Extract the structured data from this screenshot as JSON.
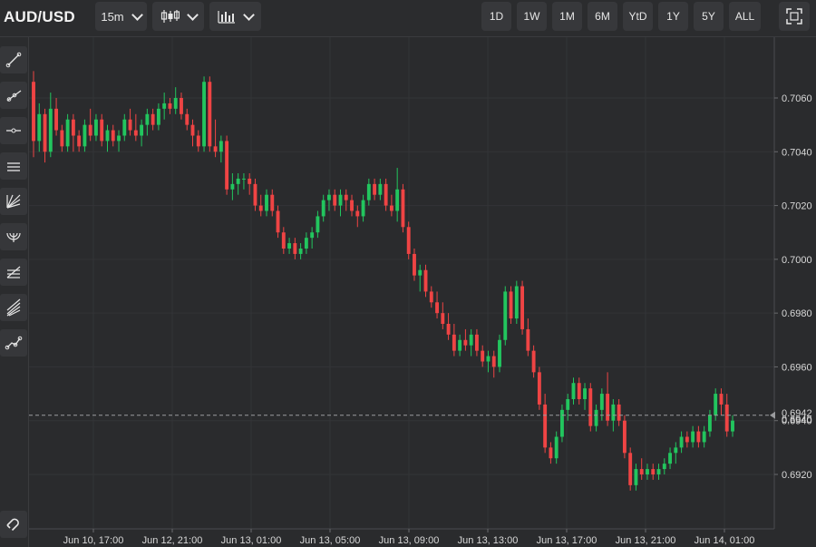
{
  "header": {
    "symbol": "AUD/USD",
    "interval": "15m",
    "chart_style_icon": "candlestick-icon",
    "indicators_icon": "indicators-icon",
    "ranges": [
      "1D",
      "1W",
      "1M",
      "6M",
      "YtD",
      "1Y",
      "5Y",
      "ALL"
    ],
    "fullscreen_icon": "fullscreen-icon"
  },
  "toolbar": {
    "tools": [
      "trend-line-icon",
      "ray-icon",
      "horizontal-line-icon",
      "parallel-channel-icon",
      "fib-fan-icon",
      "fib-arc-icon",
      "fib-retracement-icon",
      "pitchfork-icon",
      "polyline-icon"
    ],
    "bottom_tool": "magnet-icon"
  },
  "chart_data": {
    "type": "candlestick",
    "title": "",
    "ylim": [
      0.69,
      0.708
    ],
    "y_ticks": [
      "0.7060",
      "0.7040",
      "0.7020",
      "0.7000",
      "0.6980",
      "0.6960",
      "0.6940",
      "0.6920"
    ],
    "x_ticks": [
      "Jun 10, 17:00",
      "Jun 12, 21:00",
      "Jun 13, 01:00",
      "Jun 13, 05:00",
      "Jun 13, 09:00",
      "Jun 13, 13:00",
      "Jun 13, 17:00",
      "Jun 13, 21:00",
      "Jun 14, 01:00"
    ],
    "last_price_label": "0.6942",
    "last_price": 0.6942,
    "price_scale_label": "0.6940",
    "up_color": "#22c55e",
    "down_color": "#ef4444",
    "candles": [
      [
        0.7066,
        0.707,
        0.7038,
        0.7044
      ],
      [
        0.7044,
        0.7058,
        0.704,
        0.7054
      ],
      [
        0.7054,
        0.7056,
        0.7036,
        0.704
      ],
      [
        0.704,
        0.7062,
        0.7038,
        0.7056
      ],
      [
        0.7056,
        0.706,
        0.7046,
        0.7048
      ],
      [
        0.7048,
        0.705,
        0.704,
        0.7042
      ],
      [
        0.7042,
        0.7054,
        0.704,
        0.7052
      ],
      [
        0.7052,
        0.7054,
        0.704,
        0.7046
      ],
      [
        0.7046,
        0.7048,
        0.704,
        0.7042
      ],
      [
        0.7042,
        0.7052,
        0.704,
        0.705
      ],
      [
        0.705,
        0.7056,
        0.7044,
        0.7046
      ],
      [
        0.7046,
        0.7054,
        0.7044,
        0.7052
      ],
      [
        0.7052,
        0.7054,
        0.7042,
        0.7044
      ],
      [
        0.7044,
        0.705,
        0.704,
        0.7048
      ],
      [
        0.7048,
        0.705,
        0.7042,
        0.7044
      ],
      [
        0.7044,
        0.7048,
        0.704,
        0.7046
      ],
      [
        0.7046,
        0.7054,
        0.7044,
        0.7052
      ],
      [
        0.7052,
        0.7056,
        0.7046,
        0.7048
      ],
      [
        0.7048,
        0.7054,
        0.7044,
        0.7046
      ],
      [
        0.7046,
        0.7052,
        0.7042,
        0.705
      ],
      [
        0.705,
        0.7056,
        0.7046,
        0.7054
      ],
      [
        0.7054,
        0.7056,
        0.7048,
        0.705
      ],
      [
        0.705,
        0.7058,
        0.7048,
        0.7056
      ],
      [
        0.7056,
        0.7062,
        0.7052,
        0.7058
      ],
      [
        0.7058,
        0.706,
        0.7054,
        0.7056
      ],
      [
        0.7056,
        0.7064,
        0.7054,
        0.706
      ],
      [
        0.706,
        0.7062,
        0.7052,
        0.7054
      ],
      [
        0.7054,
        0.7056,
        0.7048,
        0.705
      ],
      [
        0.705,
        0.7052,
        0.7042,
        0.7046
      ],
      [
        0.7046,
        0.7048,
        0.704,
        0.7042
      ],
      [
        0.7042,
        0.7068,
        0.704,
        0.7066
      ],
      [
        0.7066,
        0.7068,
        0.704,
        0.7042
      ],
      [
        0.7042,
        0.7052,
        0.7038,
        0.704
      ],
      [
        0.704,
        0.7046,
        0.7036,
        0.7044
      ],
      [
        0.7044,
        0.7046,
        0.7024,
        0.7026
      ],
      [
        0.7026,
        0.7032,
        0.7022,
        0.7028
      ],
      [
        0.7028,
        0.7032,
        0.7024,
        0.703
      ],
      [
        0.703,
        0.7032,
        0.7026,
        0.703
      ],
      [
        0.703,
        0.7032,
        0.7024,
        0.7028
      ],
      [
        0.7028,
        0.703,
        0.7018,
        0.702
      ],
      [
        0.702,
        0.7024,
        0.7016,
        0.7018
      ],
      [
        0.7018,
        0.7026,
        0.7016,
        0.7024
      ],
      [
        0.7024,
        0.7026,
        0.7016,
        0.7018
      ],
      [
        0.7018,
        0.702,
        0.7008,
        0.701
      ],
      [
        0.701,
        0.7012,
        0.7002,
        0.7004
      ],
      [
        0.7004,
        0.7008,
        0.7002,
        0.7006
      ],
      [
        0.7006,
        0.7008,
        0.7,
        0.7002
      ],
      [
        0.7002,
        0.7006,
        0.7,
        0.7004
      ],
      [
        0.7004,
        0.701,
        0.7002,
        0.7008
      ],
      [
        0.7008,
        0.7012,
        0.7004,
        0.701
      ],
      [
        0.701,
        0.7018,
        0.7008,
        0.7016
      ],
      [
        0.7016,
        0.7024,
        0.7014,
        0.7022
      ],
      [
        0.7022,
        0.7026,
        0.7018,
        0.7024
      ],
      [
        0.7024,
        0.7026,
        0.7018,
        0.702
      ],
      [
        0.702,
        0.7026,
        0.7016,
        0.7024
      ],
      [
        0.7024,
        0.7026,
        0.7018,
        0.7022
      ],
      [
        0.7022,
        0.7024,
        0.7016,
        0.7018
      ],
      [
        0.7018,
        0.702,
        0.7012,
        0.7016
      ],
      [
        0.7016,
        0.7024,
        0.7014,
        0.7022
      ],
      [
        0.7022,
        0.703,
        0.702,
        0.7028
      ],
      [
        0.7028,
        0.703,
        0.7022,
        0.7024
      ],
      [
        0.7024,
        0.703,
        0.7022,
        0.7028
      ],
      [
        0.7028,
        0.703,
        0.7018,
        0.702
      ],
      [
        0.702,
        0.7024,
        0.7016,
        0.7018
      ],
      [
        0.7018,
        0.7034,
        0.7014,
        0.7026
      ],
      [
        0.7026,
        0.7028,
        0.701,
        0.7012
      ],
      [
        0.7012,
        0.7014,
        0.7,
        0.7002
      ],
      [
        0.7002,
        0.7004,
        0.6992,
        0.6994
      ],
      [
        0.6994,
        0.6998,
        0.6988,
        0.6996
      ],
      [
        0.6996,
        0.6998,
        0.6986,
        0.6988
      ],
      [
        0.6988,
        0.699,
        0.6982,
        0.6984
      ],
      [
        0.6984,
        0.6988,
        0.6978,
        0.698
      ],
      [
        0.698,
        0.6984,
        0.6974,
        0.6976
      ],
      [
        0.6976,
        0.698,
        0.697,
        0.6972
      ],
      [
        0.6972,
        0.6976,
        0.6964,
        0.6966
      ],
      [
        0.6966,
        0.6972,
        0.6964,
        0.697
      ],
      [
        0.697,
        0.6974,
        0.6966,
        0.6968
      ],
      [
        0.6968,
        0.6974,
        0.6964,
        0.6972
      ],
      [
        0.6972,
        0.6974,
        0.6964,
        0.6966
      ],
      [
        0.6966,
        0.6968,
        0.696,
        0.6962
      ],
      [
        0.6962,
        0.6966,
        0.6958,
        0.6964
      ],
      [
        0.6964,
        0.6966,
        0.6956,
        0.696
      ],
      [
        0.696,
        0.6972,
        0.6958,
        0.697
      ],
      [
        0.697,
        0.699,
        0.6968,
        0.6988
      ],
      [
        0.6988,
        0.699,
        0.6976,
        0.6978
      ],
      [
        0.6978,
        0.6992,
        0.6976,
        0.699
      ],
      [
        0.699,
        0.6992,
        0.6972,
        0.6974
      ],
      [
        0.6974,
        0.6978,
        0.6964,
        0.6966
      ],
      [
        0.6966,
        0.6968,
        0.6956,
        0.6958
      ],
      [
        0.6958,
        0.696,
        0.6944,
        0.6946
      ],
      [
        0.6946,
        0.695,
        0.6928,
        0.693
      ],
      [
        0.693,
        0.6932,
        0.6924,
        0.6926
      ],
      [
        0.6926,
        0.6936,
        0.6924,
        0.6934
      ],
      [
        0.6934,
        0.6946,
        0.6932,
        0.6944
      ],
      [
        0.6944,
        0.695,
        0.694,
        0.6948
      ],
      [
        0.6948,
        0.6956,
        0.6946,
        0.6954
      ],
      [
        0.6954,
        0.6956,
        0.6946,
        0.6948
      ],
      [
        0.6948,
        0.6954,
        0.6944,
        0.6952
      ],
      [
        0.6952,
        0.6954,
        0.6936,
        0.6938
      ],
      [
        0.6938,
        0.6946,
        0.6936,
        0.6944
      ],
      [
        0.6944,
        0.6952,
        0.694,
        0.695
      ],
      [
        0.695,
        0.6958,
        0.6938,
        0.694
      ],
      [
        0.694,
        0.6948,
        0.6936,
        0.6946
      ],
      [
        0.6946,
        0.6948,
        0.6938,
        0.694
      ],
      [
        0.694,
        0.6942,
        0.6926,
        0.6928
      ],
      [
        0.6928,
        0.693,
        0.6914,
        0.6916
      ],
      [
        0.6916,
        0.6924,
        0.6914,
        0.6922
      ],
      [
        0.6922,
        0.6926,
        0.6918,
        0.692
      ],
      [
        0.692,
        0.6924,
        0.6918,
        0.6922
      ],
      [
        0.6922,
        0.6924,
        0.6918,
        0.692
      ],
      [
        0.692,
        0.6924,
        0.6918,
        0.6922
      ],
      [
        0.6922,
        0.6926,
        0.692,
        0.6924
      ],
      [
        0.6924,
        0.693,
        0.6922,
        0.6928
      ],
      [
        0.6928,
        0.6932,
        0.6924,
        0.693
      ],
      [
        0.693,
        0.6936,
        0.6928,
        0.6934
      ],
      [
        0.6934,
        0.6936,
        0.693,
        0.6932
      ],
      [
        0.6932,
        0.6938,
        0.693,
        0.6936
      ],
      [
        0.6936,
        0.6938,
        0.693,
        0.6932
      ],
      [
        0.6932,
        0.6938,
        0.693,
        0.6936
      ],
      [
        0.6936,
        0.6944,
        0.6934,
        0.6942
      ],
      [
        0.6942,
        0.6952,
        0.694,
        0.695
      ],
      [
        0.695,
        0.6952,
        0.6942,
        0.6946
      ],
      [
        0.6946,
        0.695,
        0.6934,
        0.6936
      ],
      [
        0.6936,
        0.6942,
        0.6934,
        0.694
      ]
    ]
  }
}
